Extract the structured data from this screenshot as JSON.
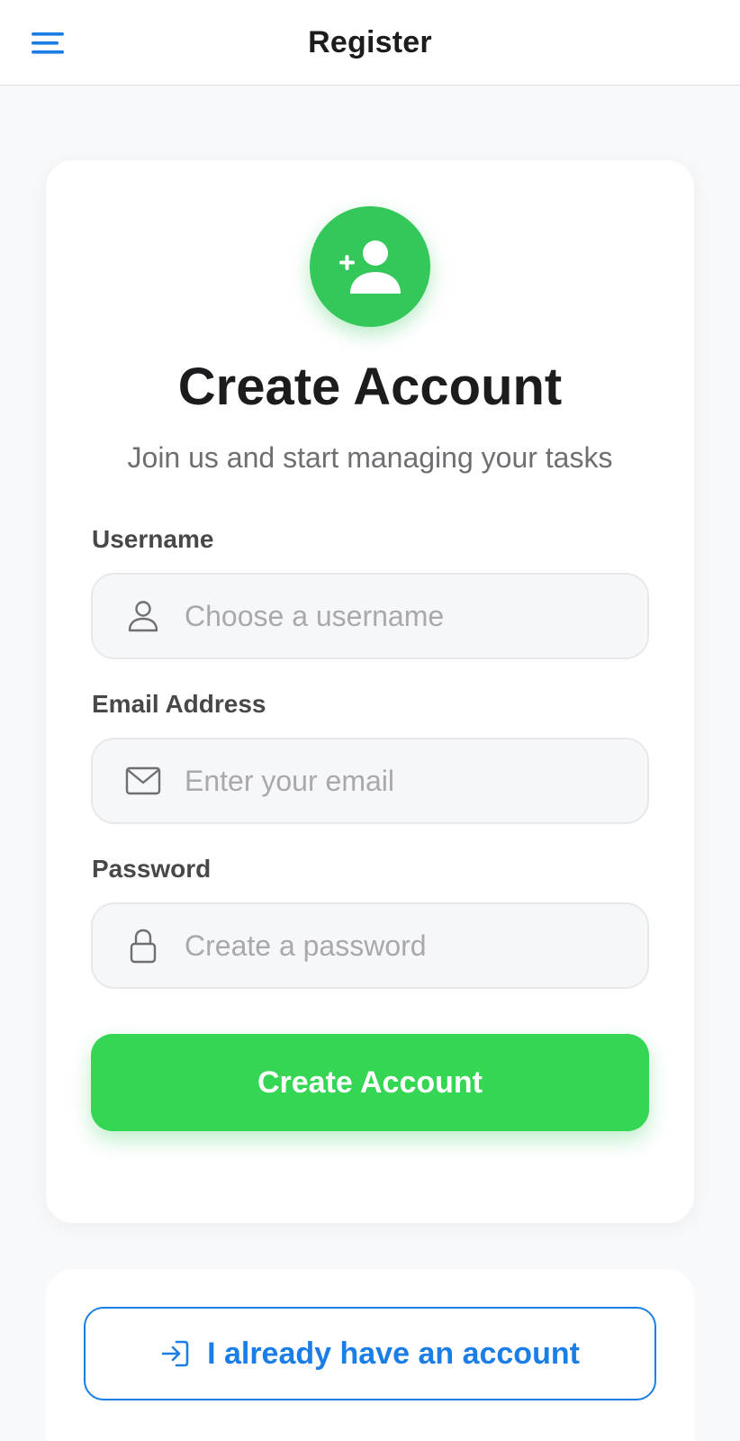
{
  "header": {
    "title": "Register",
    "menu_icon": "hamburger-menu-icon"
  },
  "card": {
    "avatar_icon": "person-add-icon",
    "title": "Create Account",
    "subtitle": "Join us and start managing your tasks"
  },
  "form": {
    "username": {
      "label": "Username",
      "placeholder": "Choose a username",
      "value": "",
      "icon": "person-icon"
    },
    "email": {
      "label": "Email Address",
      "placeholder": "Enter your email",
      "value": "",
      "icon": "envelope-icon"
    },
    "password": {
      "label": "Password",
      "placeholder": "Create a password",
      "value": "",
      "icon": "lock-icon"
    },
    "submit_label": "Create Account"
  },
  "login": {
    "label": "I already have an account",
    "icon": "sign-in-icon"
  },
  "colors": {
    "primary_green": "#34C759",
    "accent_blue": "#1B7EE6",
    "background": "#F8F9FA"
  }
}
